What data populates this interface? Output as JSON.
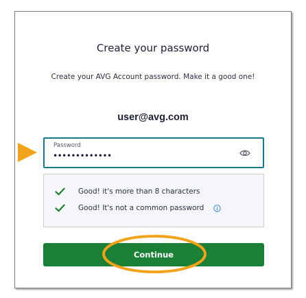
{
  "dialog": {
    "title": "Create your password",
    "subtitle": "Create your AVG Account password. Make it a good one!",
    "email": "user@avg.com"
  },
  "password_field": {
    "label": "Password",
    "value": "•••••••••••••",
    "reveal_icon": "eye-icon"
  },
  "requirements": [
    {
      "text": "Good! it's more than 8 characters",
      "icon": "check-icon"
    },
    {
      "text": "Good! It's not a common password",
      "icon": "check-icon",
      "info_icon": "info-icon"
    }
  ],
  "continue_button": {
    "label": "Continue"
  },
  "colors": {
    "accent_border": "#147a8a",
    "check_green": "#1b7f35",
    "button_green": "#1b7f35",
    "info_blue": "#2f7fd6",
    "callout_orange": "#f3a21c"
  }
}
